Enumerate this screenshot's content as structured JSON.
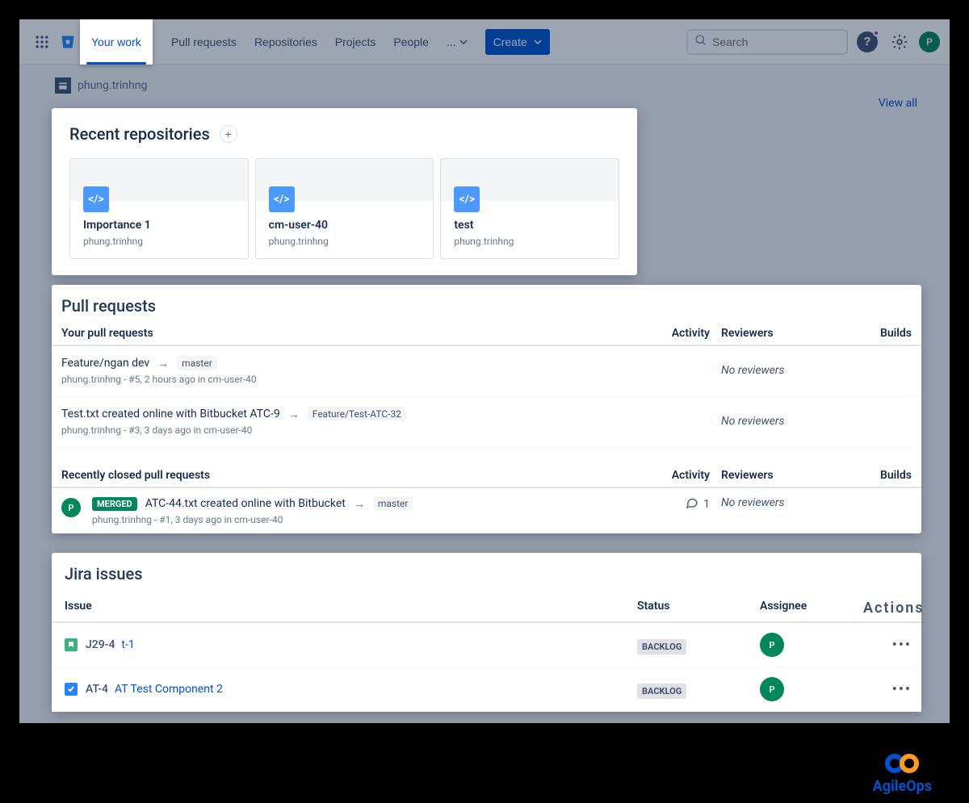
{
  "nav": {
    "items": [
      "Your work",
      "Pull requests",
      "Repositories",
      "Projects",
      "People"
    ],
    "more": "...",
    "create": "Create",
    "search_placeholder": "Search",
    "avatar_initial": "P"
  },
  "breadcrumb": {
    "user": "phung.trinhng"
  },
  "recent": {
    "heading": "Recent repositories",
    "view_all": "View all",
    "cards": [
      {
        "name": "Importance 1",
        "owner": "phung.trinhng"
      },
      {
        "name": "cm-user-40",
        "owner": "phung.trinhng"
      },
      {
        "name": "test",
        "owner": "phung.trinhng"
      }
    ]
  },
  "pull_requests": {
    "heading": "Pull requests",
    "your_heading": "Your pull requests",
    "cols": {
      "activity": "Activity",
      "reviewers": "Reviewers",
      "builds": "Builds"
    },
    "rows": [
      {
        "title": "Feature/ngan dev",
        "target": "master",
        "author": "phung.trinhng",
        "meta": "#5, 2 hours ago in cm-user-40",
        "reviewers": "No reviewers"
      },
      {
        "title": "Test.txt created online with Bitbucket ATC-9",
        "target": "Feature/Test-ATC-32",
        "author": "phung.trinhng",
        "meta": "#3, 3 days ago in cm-user-40",
        "reviewers": "No reviewers"
      }
    ],
    "closed_heading": "Recently closed pull requests",
    "closed": [
      {
        "status": "MERGED",
        "title": "ATC-44.txt created online with Bitbucket",
        "target": "master",
        "author": "phung.trinhng",
        "meta": "#1, 3 days ago in cm-user-40",
        "activity_count": "1",
        "reviewers": "No reviewers"
      }
    ]
  },
  "jira": {
    "heading": "Jira issues",
    "cols": {
      "issue": "Issue",
      "status": "Status",
      "assignee": "Assignee",
      "actions": "Actions"
    },
    "rows": [
      {
        "type": "story",
        "key": "J29-4",
        "summary": "t-1",
        "status": "BACKLOG",
        "assignee": "P"
      },
      {
        "type": "task",
        "key": "AT-4",
        "summary": "AT Test Component 2",
        "status": "BACKLOG",
        "assignee": "P"
      }
    ]
  },
  "footer_logo": "AgileOps"
}
